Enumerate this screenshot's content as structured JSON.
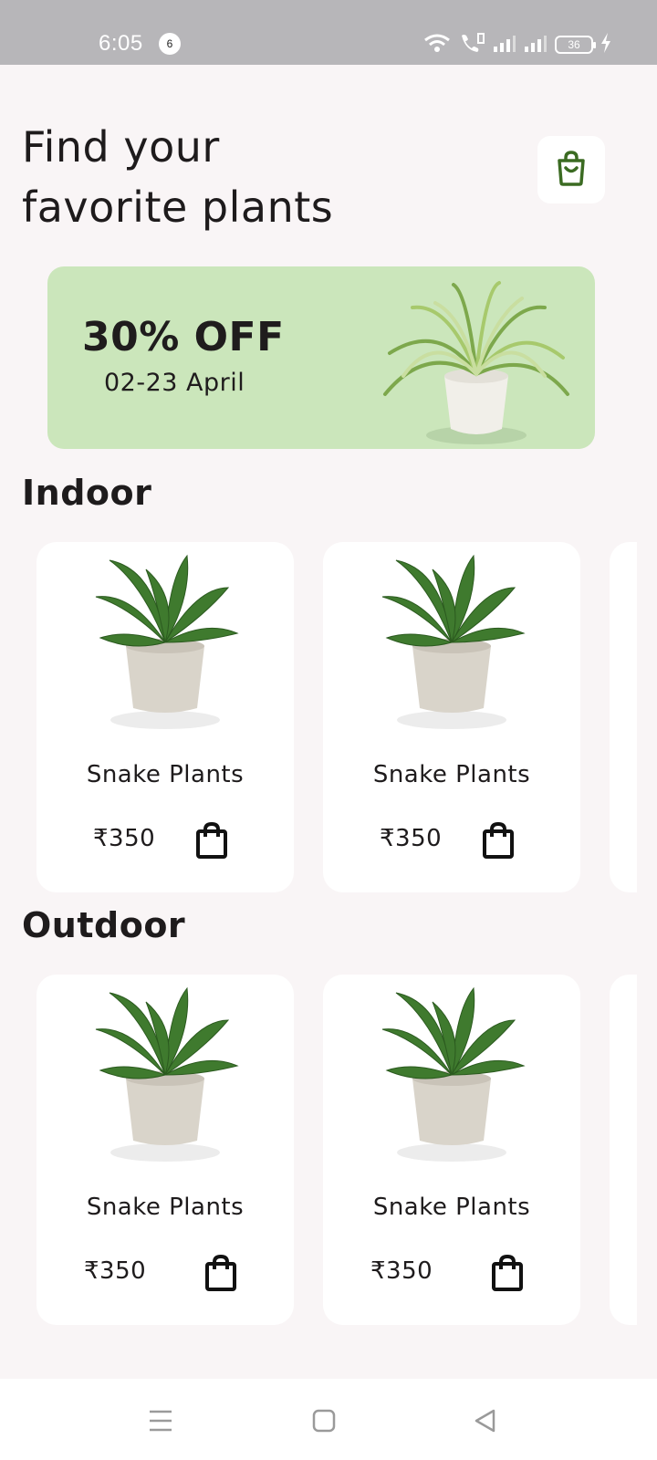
{
  "status_bar": {
    "time": "6:05",
    "notification_count": "6",
    "battery": "36"
  },
  "header": {
    "title_line1": "Find your",
    "title_line2": "favorite plants",
    "cart_icon": "shopping-bag-icon"
  },
  "promo": {
    "discount": "30% OFF",
    "dates": "02-23 April",
    "color": "#cbe6bb"
  },
  "sections": [
    {
      "title": "Indoor",
      "products": [
        {
          "name": "Snake Plants",
          "price": "₹350"
        },
        {
          "name": "Snake Plants",
          "price": "₹350"
        }
      ]
    },
    {
      "title": "Outdoor",
      "products": [
        {
          "name": "Snake Plants",
          "price": "₹350"
        },
        {
          "name": "Snake Plants",
          "price": "₹350"
        }
      ]
    }
  ],
  "colors": {
    "accent_green": "#3b6b22",
    "background": "#f9f5f6",
    "card": "#ffffff"
  },
  "nav": {
    "icons": [
      "menu-icon",
      "home-square-icon",
      "back-triangle-icon"
    ]
  }
}
